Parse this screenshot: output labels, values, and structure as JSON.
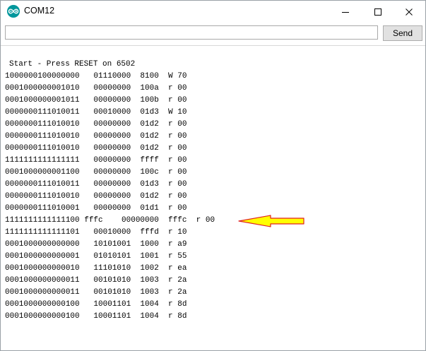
{
  "window": {
    "title": "COM12",
    "icon": "arduino-infinity-icon",
    "controls": [
      "minimize-icon",
      "maximize-icon",
      "close-icon"
    ]
  },
  "send_bar": {
    "input_value": "",
    "button_label": "Send"
  },
  "output": {
    "header": "Start - Press RESET on 6502",
    "lines": [
      "1000000100000000   01110000  8100  W 70",
      "0001000000001010   00000000  100a  r 00",
      "0001000000001011   00000000  100b  r 00",
      "0000000111010011   00010000  01d3  W 10",
      "0000000111010010   00000000  01d2  r 00",
      "0000000111010010   00000000  01d2  r 00",
      "0000000111010010   00000000  01d2  r 00",
      "1111111111111111   00000000  ffff  r 00",
      "0001000000001100   00000000  100c  r 00",
      "0000000111010011   00000000  01d3  r 00",
      "0000000111010010   00000000  01d2  r 00",
      "0000000111010001   00000000  01d1  r 00",
      "1111111111111100 fffc    00000000  fffc  r 00",
      "1111111111111101   00010000  fffd  r 10",
      "0001000000000000   10101001  1000  r a9",
      "0001000000000001   01010101  1001  r 55",
      "0001000000000010   11101010  1002  r ea",
      "0001000000000011   00101010  1003  r 2a",
      "0001000000000011   00101010  1003  r 2a",
      "0001000000000100   10001101  1004  r 8d",
      "0001000000000100   10001101  1004  r 8d"
    ]
  },
  "annotation": {
    "icon": "yellow-arrow-left-icon",
    "fill": "#ffff00",
    "stroke": "#e02020"
  },
  "colors": {
    "arduino_teal": "#00979c"
  }
}
